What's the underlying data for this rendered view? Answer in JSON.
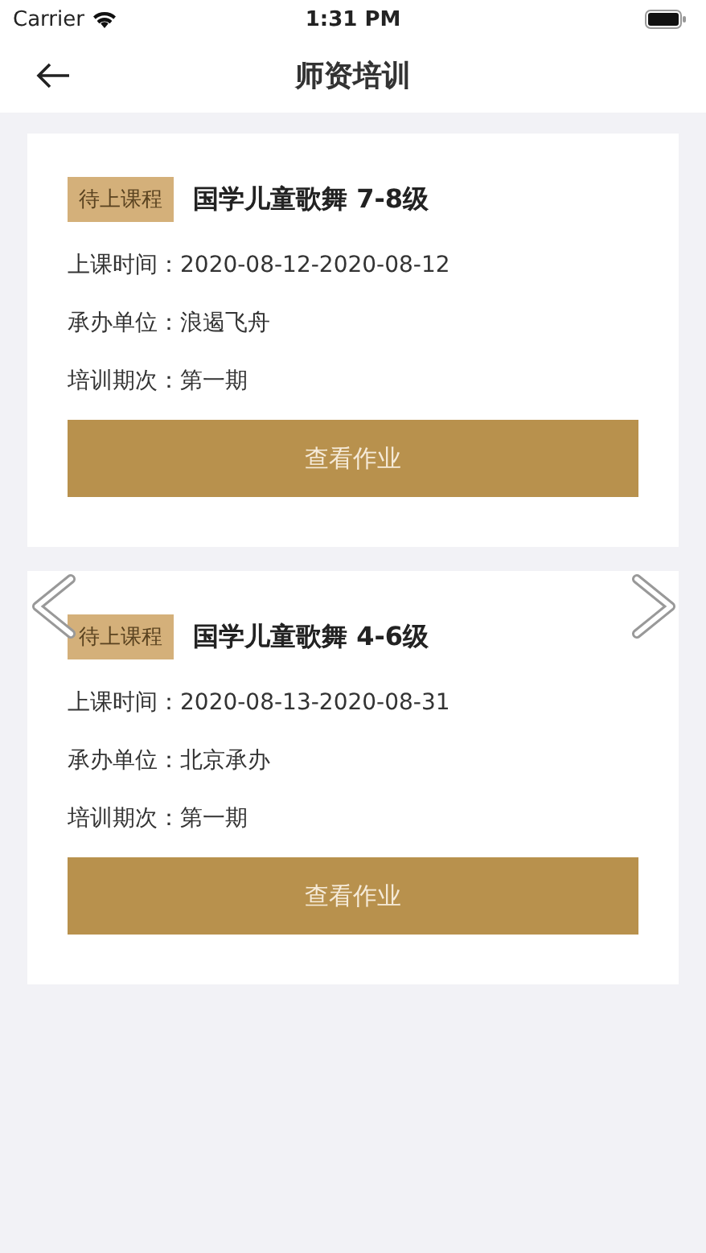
{
  "status_bar": {
    "carrier": "Carrier",
    "time": "1:31 PM"
  },
  "nav": {
    "title": "师资培训"
  },
  "courses": [
    {
      "tag": "待上课程",
      "name": "国学儿童歌舞 7-8级",
      "details": [
        "上课时间：2020-08-12-2020-08-12",
        "承办单位：浪遏飞舟",
        "培训期次：第一期"
      ],
      "button": "查看作业"
    },
    {
      "tag": "待上课程",
      "name": "国学儿童歌舞 4-6级",
      "details": [
        "上课时间：2020-08-13-2020-08-31",
        "承办单位：北京承办",
        "培训期次：第一期"
      ],
      "button": "查看作业"
    }
  ]
}
